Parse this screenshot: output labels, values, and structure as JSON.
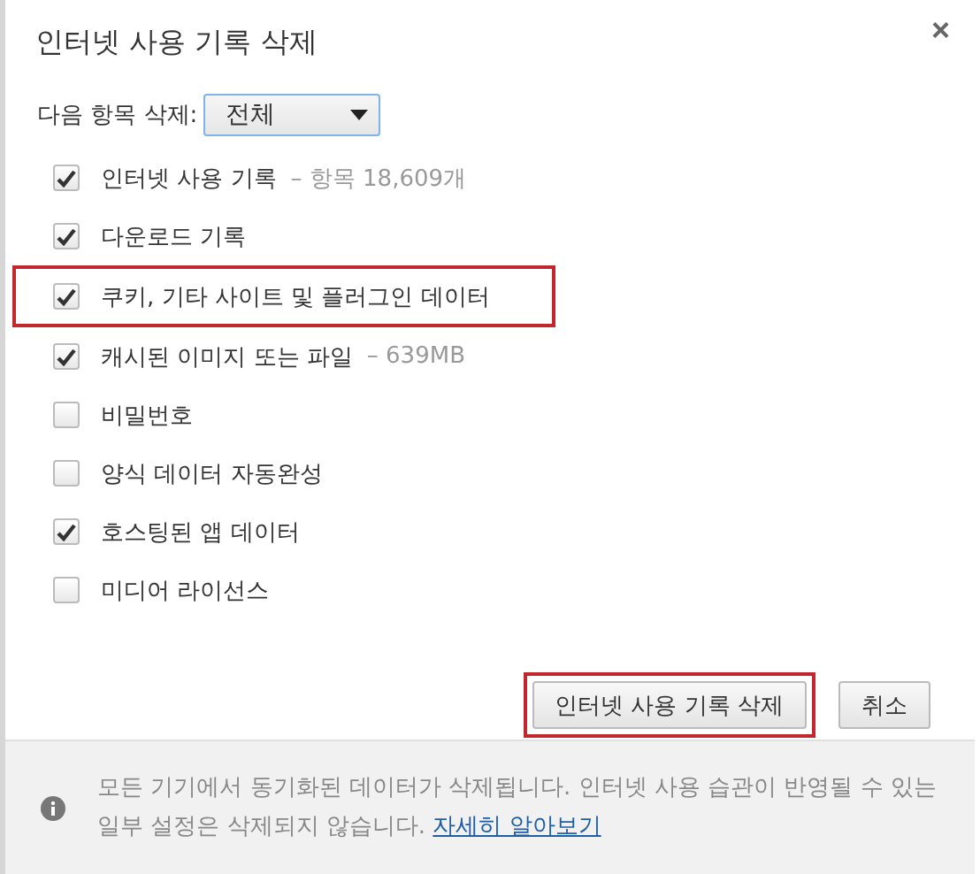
{
  "dialog": {
    "title": "인터넷 사용 기록 삭제",
    "close": "×"
  },
  "range": {
    "label": "다음 항목 삭제:",
    "value": "전체"
  },
  "items": [
    {
      "label": "인터넷 사용 기록",
      "detail": "–  항목 18,609개",
      "checked": true,
      "highlighted": false
    },
    {
      "label": "다운로드 기록",
      "checked": true,
      "highlighted": false
    },
    {
      "label": "쿠키, 기타 사이트 및 플러그인 데이터",
      "checked": true,
      "highlighted": true
    },
    {
      "label": "캐시된 이미지 또는 파일",
      "detail": "–  639MB",
      "checked": true,
      "highlighted": false
    },
    {
      "label": "비밀번호",
      "checked": false,
      "highlighted": false
    },
    {
      "label": "양식 데이터 자동완성",
      "checked": false,
      "highlighted": false
    },
    {
      "label": "호스팅된 앱 데이터",
      "checked": true,
      "highlighted": false
    },
    {
      "label": "미디어 라이선스",
      "checked": false,
      "highlighted": false
    }
  ],
  "buttons": [
    {
      "label": "인터넷 사용 기록 삭제",
      "highlighted": true
    },
    {
      "label": "취소",
      "highlighted": false
    }
  ],
  "footer": {
    "text": "모든 기기에서 동기화된 데이터가 삭제됩니다. 인터넷 사용 습관이 반영될 수 있는 일부 설정은 삭제되지 않습니다.",
    "link": "자세히 알아보기"
  }
}
